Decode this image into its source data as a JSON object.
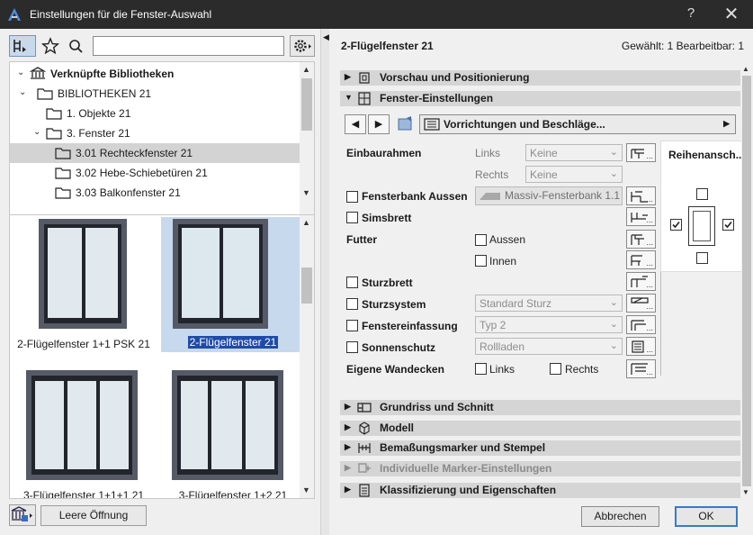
{
  "window": {
    "title": "Einstellungen für die Fenster-Auswahl",
    "help_label": "?",
    "close_label": "✕"
  },
  "library": {
    "search_value": "",
    "tree": [
      {
        "label": "Verknüpfte Bibliotheken",
        "level": 0,
        "expanded": true,
        "bold": true
      },
      {
        "label": "BIBLIOTHEKEN 21",
        "level": 1,
        "expanded": true
      },
      {
        "label": "1. Objekte 21",
        "level": 2,
        "expanded": false
      },
      {
        "label": "3. Fenster 21",
        "level": 2,
        "expanded": true
      },
      {
        "label": "3.01 Rechteckfenster 21",
        "level": 3,
        "selected": true
      },
      {
        "label": "3.02 Hebe-Schiebetüren 21",
        "level": 3
      },
      {
        "label": "3.03 Balkonfenster 21",
        "level": 3
      }
    ],
    "items": [
      {
        "label": "2-Flügelfenster 1+1 PSK 21",
        "panes": 2,
        "selected": false
      },
      {
        "label": "2-Flügelfenster 21",
        "panes": 2,
        "selected": true
      },
      {
        "label": "3-Flügelfenster 1+1+1 21",
        "panes": 3,
        "selected": false
      },
      {
        "label": "3-Flügelfenster 1+2 21",
        "panes": 3,
        "selected": false
      }
    ],
    "empty_opening_label": "Leere Öffnung"
  },
  "settings": {
    "header_title": "2-Flügelfenster 21",
    "status": "Gewählt: 1 Bearbeitbar: 1",
    "sections_top": [
      {
        "label": "Vorschau und Positionierung",
        "expanded": false
      },
      {
        "label": "Fenster-Einstellungen",
        "expanded": true
      }
    ],
    "panel_selector": "Vorrichtungen und Beschläge...",
    "rows": {
      "einbaurahmen": "Einbaurahmen",
      "links": "Links",
      "rechts": "Rechts",
      "keine_links": "Keine",
      "keine_rechts": "Keine",
      "fensterbank_aussen": "Fensterbank Aussen",
      "fensterbank_value": "Massiv-Fensterbank 1.1",
      "simsbrett": "Simsbrett",
      "futter": "Futter",
      "aussen": "Aussen",
      "innen": "Innen",
      "sturzbrett": "Sturzbrett",
      "sturzsystem": "Sturzsystem",
      "sturzsystem_value": "Standard Sturz",
      "fenstereinfassung": "Fenstereinfassung",
      "fenstereinfassung_value": "Typ 2",
      "sonnenschutz": "Sonnenschutz",
      "sonnenschutz_value": "Rollladen",
      "eigene_wandecken": "Eigene Wandecken",
      "wand_links": "Links",
      "wand_rechts": "Rechts"
    },
    "series_view_title": "Reihenansch...",
    "series_view_checks": {
      "top": false,
      "left": true,
      "right": true,
      "bottom": false
    },
    "sections_bottom": [
      {
        "label": "Grundriss und Schnitt",
        "disabled": false
      },
      {
        "label": "Modell",
        "disabled": false
      },
      {
        "label": "Bemaßungsmarker und Stempel",
        "disabled": false
      },
      {
        "label": "Individuelle Marker-Einstellungen",
        "disabled": true
      },
      {
        "label": "Klassifizierung und Eigenschaften",
        "disabled": false
      }
    ],
    "cancel_label": "Abbrechen",
    "ok_label": "OK"
  },
  "colors": {
    "titlebar": "#2b2b2b",
    "selection_blue": "#1f4ba8",
    "section_header": "#d5d5d5",
    "ok_border": "#3a79c9"
  }
}
